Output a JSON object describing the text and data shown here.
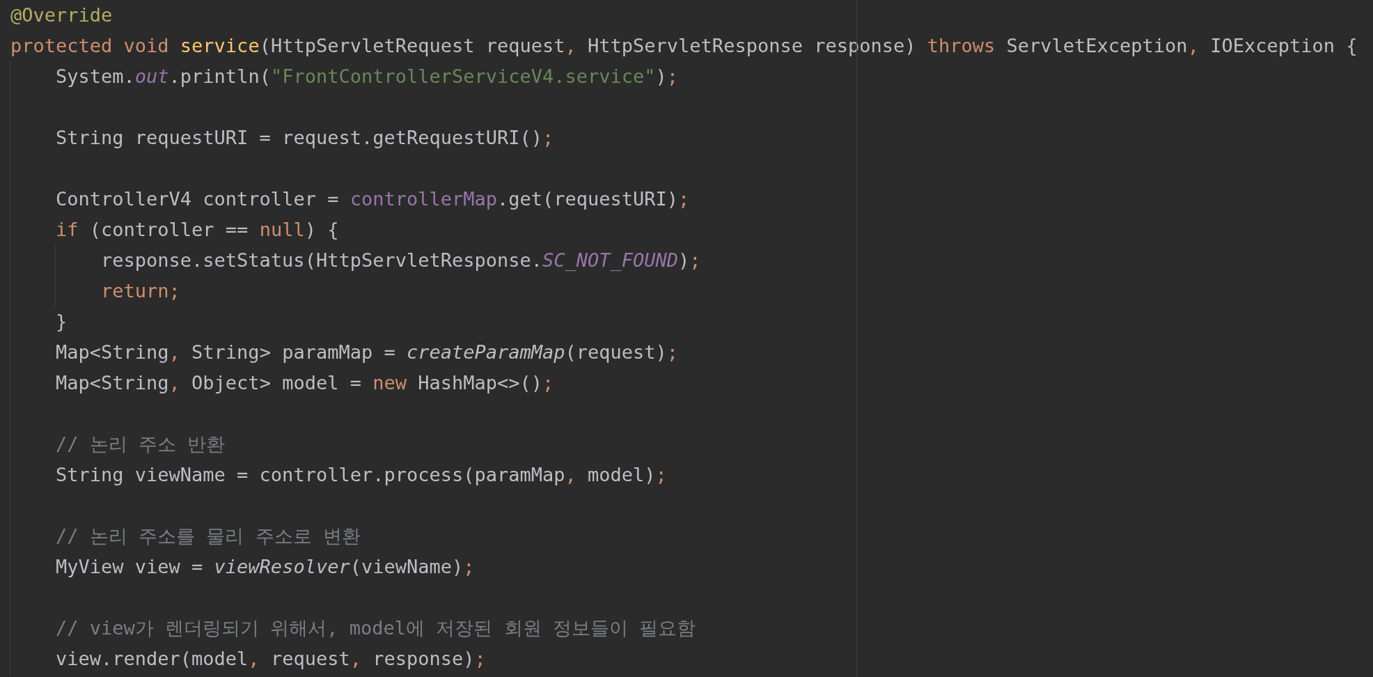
{
  "editor": {
    "lines": [
      {
        "kind": "code",
        "tokens": [
          {
            "text": "@Override",
            "kind": "annotation"
          }
        ]
      },
      {
        "kind": "code",
        "tokens": [
          {
            "text": "protected void ",
            "kind": "keyword"
          },
          {
            "text": "service",
            "kind": "decl"
          },
          {
            "text": "(HttpServletRequest request",
            "kind": "plain"
          },
          {
            "text": ", ",
            "kind": "punct"
          },
          {
            "text": "HttpServletResponse response) ",
            "kind": "plain"
          },
          {
            "text": "throws ",
            "kind": "keyword"
          },
          {
            "text": "ServletException",
            "kind": "plain"
          },
          {
            "text": ", ",
            "kind": "punct"
          },
          {
            "text": "IOException {",
            "kind": "plain"
          }
        ],
        "children": [
          {
            "kind": "code",
            "tokens": [
              {
                "text": "System.",
                "kind": "plain"
              },
              {
                "text": "out",
                "kind": "static"
              },
              {
                "text": ".println(",
                "kind": "plain"
              },
              {
                "text": "\"FrontControllerServiceV4.service\"",
                "kind": "string"
              },
              {
                "text": ")",
                "kind": "plain"
              },
              {
                "text": ";",
                "kind": "punct"
              }
            ]
          },
          {
            "kind": "blank"
          },
          {
            "kind": "code",
            "tokens": [
              {
                "text": "String requestURI = request.getRequestURI()",
                "kind": "plain"
              },
              {
                "text": ";",
                "kind": "punct"
              }
            ]
          },
          {
            "kind": "blank"
          },
          {
            "kind": "code",
            "tokens": [
              {
                "text": "ControllerV4 controller = ",
                "kind": "plain"
              },
              {
                "text": "controllerMap",
                "kind": "field"
              },
              {
                "text": ".get(requestURI)",
                "kind": "plain"
              },
              {
                "text": ";",
                "kind": "punct"
              }
            ]
          },
          {
            "kind": "code",
            "tokens": [
              {
                "text": "if ",
                "kind": "keyword"
              },
              {
                "text": "(controller == ",
                "kind": "plain"
              },
              {
                "text": "null",
                "kind": "keyword"
              },
              {
                "text": ") {",
                "kind": "plain"
              }
            ],
            "children": [
              {
                "kind": "code",
                "tokens": [
                  {
                    "text": "response.setStatus(HttpServletResponse.",
                    "kind": "plain"
                  },
                  {
                    "text": "SC_NOT_FOUND",
                    "kind": "static"
                  },
                  {
                    "text": ")",
                    "kind": "plain"
                  },
                  {
                    "text": ";",
                    "kind": "punct"
                  }
                ]
              },
              {
                "kind": "code",
                "tokens": [
                  {
                    "text": "return",
                    "kind": "keyword"
                  },
                  {
                    "text": ";",
                    "kind": "punct"
                  }
                ]
              }
            ]
          },
          {
            "kind": "code",
            "tokens": [
              {
                "text": "}",
                "kind": "plain"
              }
            ]
          },
          {
            "kind": "code",
            "tokens": [
              {
                "text": "Map<String",
                "kind": "plain"
              },
              {
                "text": ", ",
                "kind": "punct"
              },
              {
                "text": "String> paramMap = ",
                "kind": "plain"
              },
              {
                "text": "createParamMap",
                "kind": "italic"
              },
              {
                "text": "(request)",
                "kind": "plain"
              },
              {
                "text": ";",
                "kind": "punct"
              }
            ]
          },
          {
            "kind": "code",
            "tokens": [
              {
                "text": "Map<String",
                "kind": "plain"
              },
              {
                "text": ", ",
                "kind": "punct"
              },
              {
                "text": "Object> model = ",
                "kind": "plain"
              },
              {
                "text": "new ",
                "kind": "keyword"
              },
              {
                "text": "HashMap<>()",
                "kind": "plain"
              },
              {
                "text": ";",
                "kind": "punct"
              }
            ]
          },
          {
            "kind": "blank"
          },
          {
            "kind": "code",
            "tokens": [
              {
                "text": "// 논리 주소 반환",
                "kind": "comment"
              }
            ]
          },
          {
            "kind": "code",
            "tokens": [
              {
                "text": "String viewName = controller.process(paramMap",
                "kind": "plain"
              },
              {
                "text": ", ",
                "kind": "punct"
              },
              {
                "text": "model)",
                "kind": "plain"
              },
              {
                "text": ";",
                "kind": "punct"
              }
            ]
          },
          {
            "kind": "blank"
          },
          {
            "kind": "code",
            "tokens": [
              {
                "text": "// 논리 주소를 물리 주소로 변환",
                "kind": "comment"
              }
            ]
          },
          {
            "kind": "code",
            "tokens": [
              {
                "text": "MyView view = ",
                "kind": "plain"
              },
              {
                "text": "viewResolver",
                "kind": "italic"
              },
              {
                "text": "(viewName)",
                "kind": "plain"
              },
              {
                "text": ";",
                "kind": "punct"
              }
            ]
          },
          {
            "kind": "blank"
          },
          {
            "kind": "code",
            "tokens": [
              {
                "text": "// view가 렌더링되기 위해서, model에 저장된 회원 정보들이 필요함",
                "kind": "comment"
              }
            ]
          },
          {
            "kind": "code",
            "tokens": [
              {
                "text": "view.render(model",
                "kind": "plain"
              },
              {
                "text": ", ",
                "kind": "punct"
              },
              {
                "text": "request",
                "kind": "plain"
              },
              {
                "text": ", ",
                "kind": "punct"
              },
              {
                "text": "response)",
                "kind": "plain"
              },
              {
                "text": ";",
                "kind": "punct"
              }
            ]
          }
        ]
      }
    ]
  }
}
